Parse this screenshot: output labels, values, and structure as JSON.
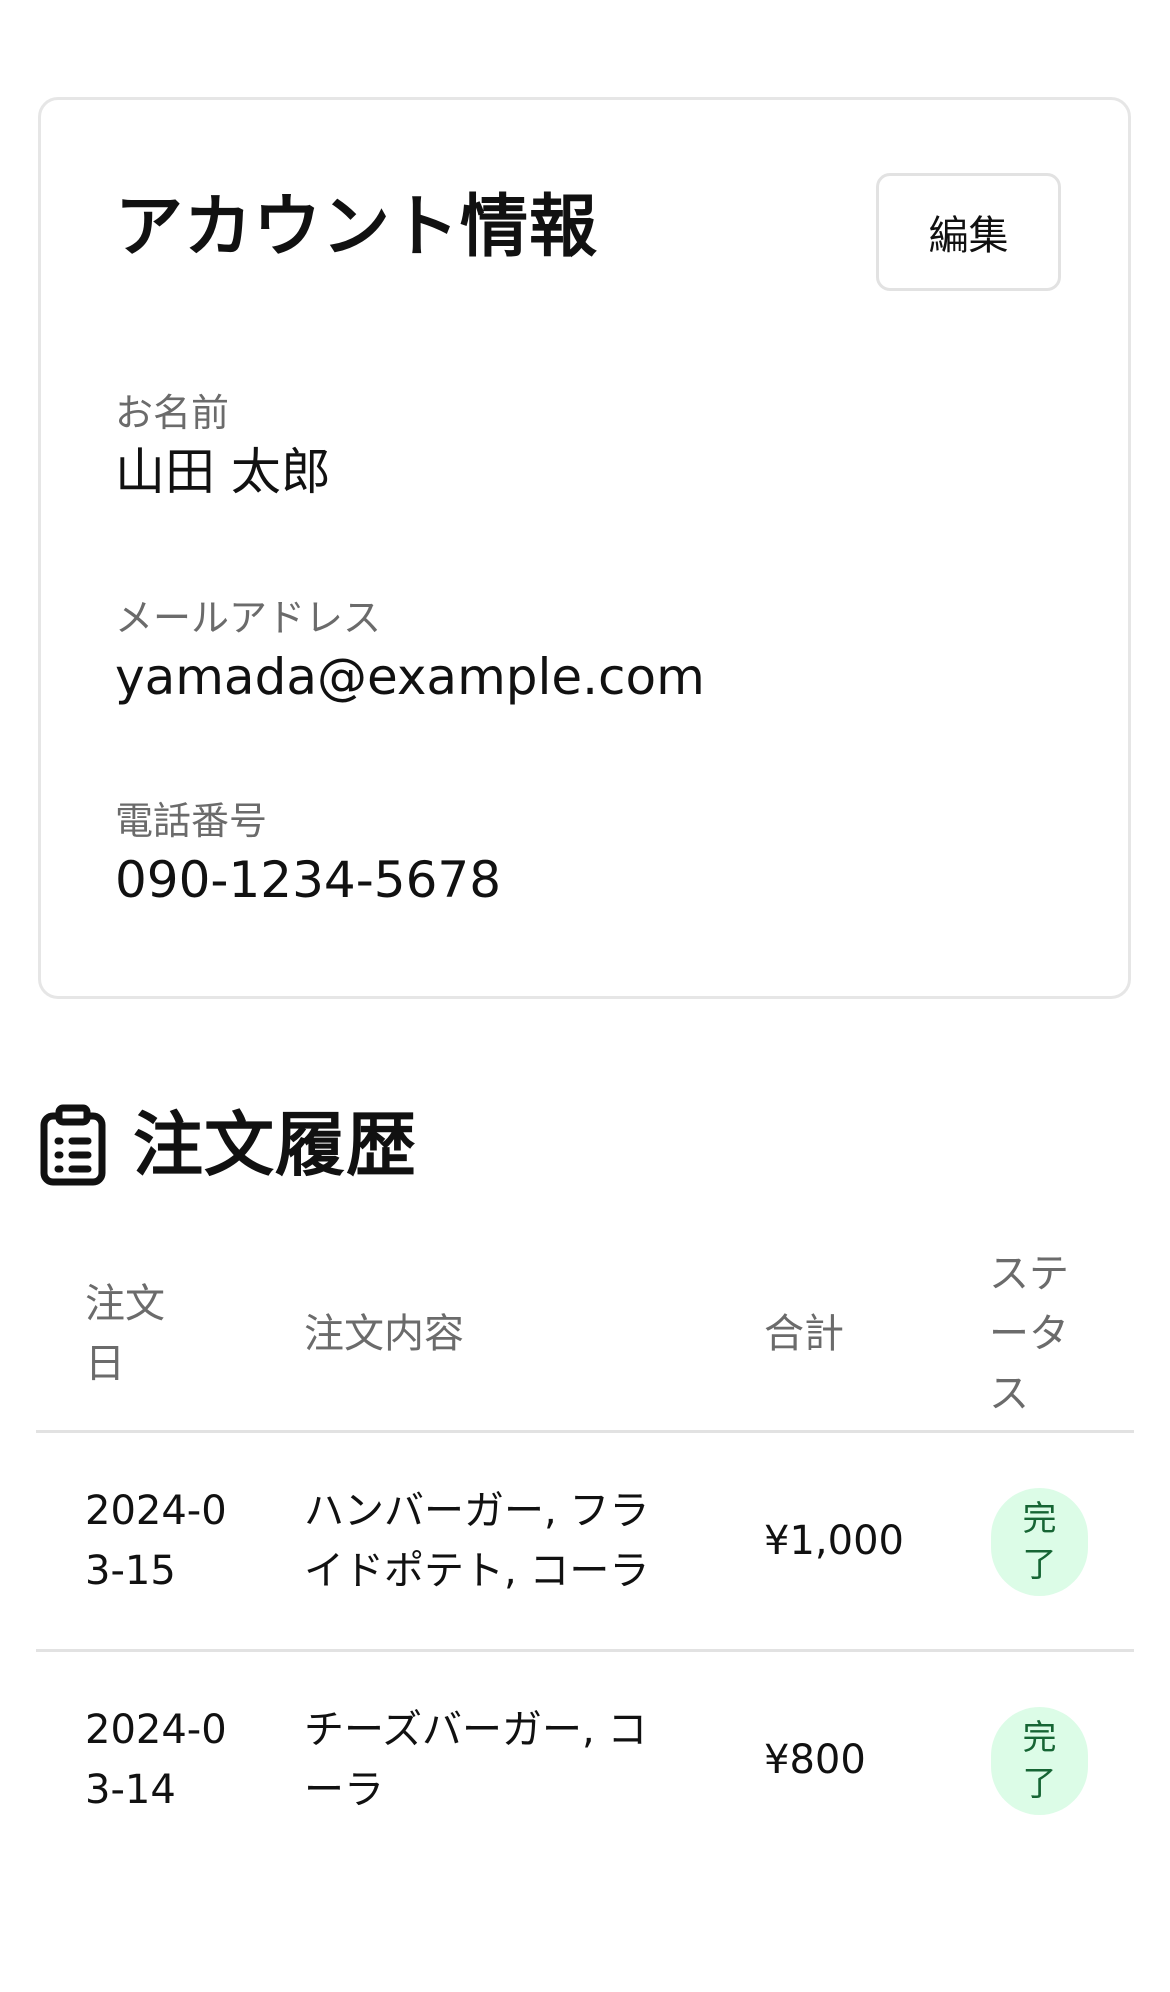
{
  "account": {
    "title": "アカウント情報",
    "edit_label": "編集",
    "name_label": "お名前",
    "name_value": "山田 太郎",
    "email_label": "メールアドレス",
    "email_value": "yamada@example.com",
    "phone_label": "電話番号",
    "phone_value": "090-1234-5678"
  },
  "history": {
    "title": "注文履歴",
    "icon": "clipboard-list-icon",
    "columns": {
      "date": "注文日",
      "items": "注文内容",
      "total": "合計",
      "status": "ステータス"
    },
    "rows": [
      {
        "date": "2024-03-15",
        "items": "ハンバーガー, フライドポテト, コーラ",
        "total": "¥1,000",
        "status": "完了"
      },
      {
        "date": "2024-03-14",
        "items": "チーズバーガー, コーラ",
        "total": "¥800",
        "status": "完了"
      }
    ]
  },
  "colors": {
    "status_badge_bg": "#dcfce7",
    "status_badge_text": "#166534",
    "label_gray": "#6b6b6b",
    "border": "#e2e2e2"
  }
}
